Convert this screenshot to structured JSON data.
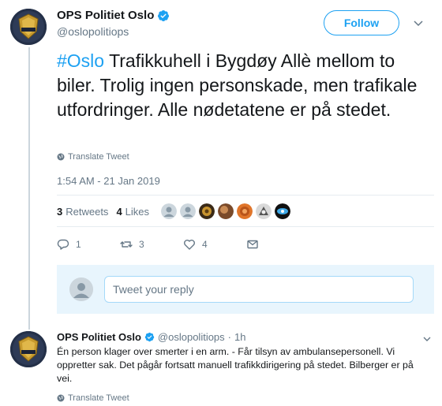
{
  "tweet": {
    "author_name": "OPS Politiet Oslo",
    "handle": "@oslopolitiops",
    "follow_label": "Follow",
    "hashtag": "#Oslo",
    "text": " Trafikkuhell i Bygdøy Allè mellom to biler. Trolig ingen personskade, men trafikale utfordringer. Alle nødetatene er på stedet.",
    "translate_label": "Translate Tweet",
    "timestamp": "1:54 AM - 21 Jan 2019",
    "retweets_count": "3",
    "retweets_label": "Retweets",
    "likes_count": "4",
    "likes_label": "Likes",
    "actions": {
      "reply_count": "1",
      "retweet_count": "3",
      "like_count": "4"
    }
  },
  "reply_box": {
    "placeholder": "Tweet your reply"
  },
  "reply": {
    "author_name": "OPS Politiet Oslo",
    "handle": "@oslopolitiops",
    "separator": "·",
    "age": "1h",
    "text": "Én person klager over smerter i en arm. - Får tilsyn av ambulansepersonell. Vi oppretter sak. Det pågår fortsatt manuell trafikkdirigering på stedet. Bilberger er på vei.",
    "translate_label": "Translate Tweet"
  },
  "colors": {
    "accent": "#1da1f2",
    "text": "#14171a",
    "muted": "#657786"
  },
  "icons": [
    "police-badge-avatar",
    "verified-badge-icon",
    "chevron-down-icon",
    "globe-icon",
    "reply-icon",
    "retweet-icon",
    "heart-icon",
    "message-icon",
    "default-avatar-icon"
  ]
}
